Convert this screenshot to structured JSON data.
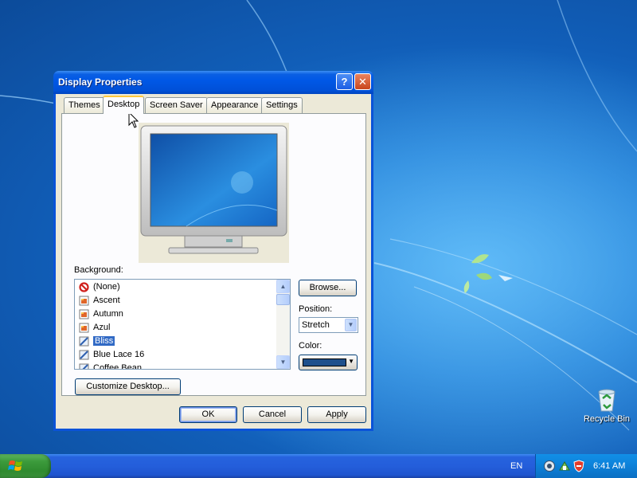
{
  "colors": {
    "desktop_blue": "#1f7fd8",
    "selected_background_color": "#1e4f8c",
    "selection_highlight": "#316ac5"
  },
  "desktop": {
    "recycle_bin_label": "Recycle Bin"
  },
  "window": {
    "title": "Display Properties",
    "help_glyph": "?",
    "close_glyph": "✕",
    "tabs": [
      {
        "label": "Themes"
      },
      {
        "label": "Desktop",
        "active": true
      },
      {
        "label": "Screen Saver"
      },
      {
        "label": "Appearance"
      },
      {
        "label": "Settings"
      }
    ],
    "desktop_tab": {
      "background_label": "Background:",
      "backgrounds": [
        {
          "label": "(None)",
          "icon": "none-icon"
        },
        {
          "label": "Ascent",
          "icon": "image-file-icon"
        },
        {
          "label": "Autumn",
          "icon": "image-file-icon"
        },
        {
          "label": "Azul",
          "icon": "image-file-icon"
        },
        {
          "label": "Bliss",
          "icon": "bitmap-file-icon",
          "selected": true
        },
        {
          "label": "Blue Lace 16",
          "icon": "bitmap-file-icon"
        },
        {
          "label": "Coffee Bean",
          "icon": "bitmap-file-icon"
        }
      ],
      "browse_label": "Browse...",
      "position_label": "Position:",
      "position_value": "Stretch",
      "color_label": "Color:",
      "customize_label": "Customize Desktop..."
    },
    "buttons": {
      "ok": "OK",
      "cancel": "Cancel",
      "apply": "Apply"
    }
  },
  "taskbar": {
    "language": "EN",
    "clock": "6:41 AM"
  }
}
